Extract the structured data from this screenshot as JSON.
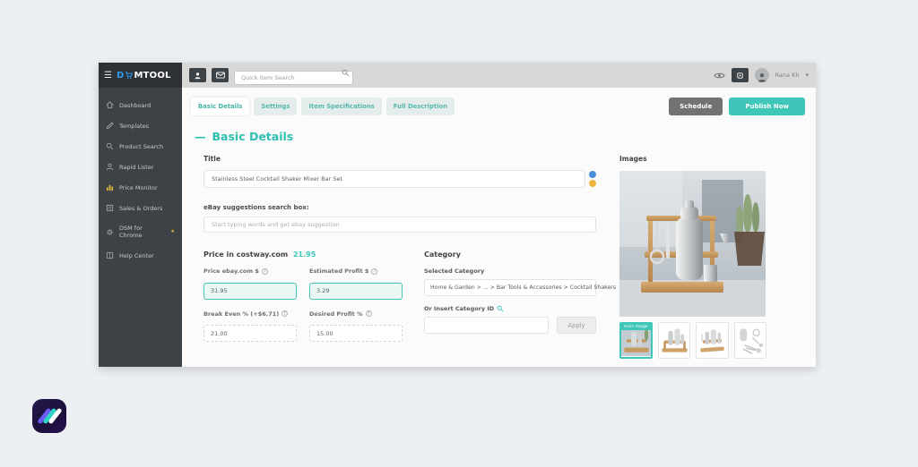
{
  "brand": {
    "part1": "D",
    "part2": "MTOOL"
  },
  "sidebar": {
    "items": [
      {
        "label": "Dashboard"
      },
      {
        "label": "Templates"
      },
      {
        "label": "Product Search"
      },
      {
        "label": "Rapid Lister"
      },
      {
        "label": "Price Monitor"
      },
      {
        "label": "Sales & Orders"
      },
      {
        "label": "DSM for Chrome",
        "badge": "★"
      },
      {
        "label": "Help Center"
      }
    ]
  },
  "topbar": {
    "search_placeholder": "Quick Item Search",
    "user_name": "Rana Kh"
  },
  "tabs": [
    {
      "label": "Basic Details"
    },
    {
      "label": "Settings"
    },
    {
      "label": "Item Specifications"
    },
    {
      "label": "Full Description"
    }
  ],
  "actions": {
    "schedule": "Schedule",
    "publish": "Publish Now"
  },
  "main": {
    "heading_dash": "—",
    "heading": "Basic Details"
  },
  "form": {
    "title_label": "Title",
    "title_value": "Stainless Steel Cocktail Shaker Mixer Bar Set",
    "ebay_label": "eBay suggestions search box:",
    "ebay_placeholder": "Start typing words and get ebay suggestion",
    "price_heading": "Price in costway.com",
    "price_source_value": "21.95",
    "price_fields": [
      {
        "label": "Price ebay.com $",
        "value": "31.95"
      },
      {
        "label": "Estimated Profit $",
        "value": "3.29"
      },
      {
        "label": "Break Even % (+$6.71)",
        "value": "21.00"
      },
      {
        "label": "Desired Profit %",
        "value": "15.00"
      }
    ],
    "category_heading": "Category",
    "selected_category_label": "Selected Category",
    "selected_category_value": "Home & Garden > ... > Bar Tools & Accessories > Cocktail Shakers",
    "insert_category_label": "Or Insert Category ID",
    "apply_label": "Apply"
  },
  "images": {
    "heading": "Images",
    "main_image_badge": "main image"
  },
  "colors": {
    "accent": "#3ec6b9",
    "highlight_bg": "#e9f8f5",
    "info_badge": "#4a90d9",
    "warning_badge": "#f0b43f"
  }
}
